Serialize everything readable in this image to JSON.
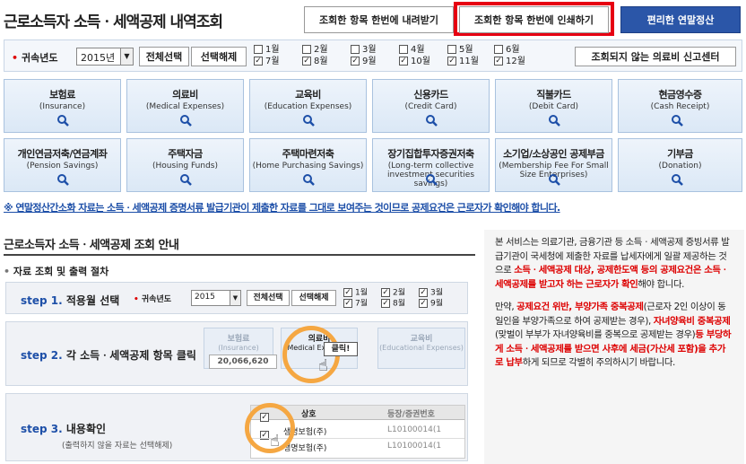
{
  "header": {
    "title": "근로소득자 소득ㆍ세액공제 내역조회",
    "download_label": "조회한 항목 한번에 내려받기",
    "print_label": "조회한 항목 한번에 인쇄하기",
    "easy_label": "편리한 연말정산"
  },
  "filter": {
    "year_label": "귀속년도",
    "year_value": "2015년",
    "select_all_label": "전체선택",
    "deselect_label": "선택해제",
    "months": [
      {
        "top": "1월",
        "bottom": "7월"
      },
      {
        "top": "2월",
        "bottom": "8월"
      },
      {
        "top": "3월",
        "bottom": "9월"
      },
      {
        "top": "4월",
        "bottom": "10월"
      },
      {
        "top": "5월",
        "bottom": "11월"
      },
      {
        "top": "6월",
        "bottom": "12월"
      }
    ],
    "report_label": "조회되지 않는 의료비 신고센터"
  },
  "cards": [
    {
      "k": "보험료",
      "e": "(Insurance)"
    },
    {
      "k": "의료비",
      "e": "(Medical Expenses)"
    },
    {
      "k": "교육비",
      "e": "(Education Expenses)"
    },
    {
      "k": "신용카드",
      "e": "(Credit Card)"
    },
    {
      "k": "직불카드",
      "e": "(Debit Card)"
    },
    {
      "k": "현금영수증",
      "e": "(Cash Receipt)"
    },
    {
      "k": "개인연금저축/연금계좌",
      "e": "(Pension Savings)"
    },
    {
      "k": "주택자금",
      "e": "(Housing Funds)"
    },
    {
      "k": "주택마련저축",
      "e": "(Home Purchasing Savings)"
    },
    {
      "k": "장기집합투자증권저축",
      "e": "(Long-term collective investment securities savings)"
    },
    {
      "k": "소기업/소상공인 공제부금",
      "e": "(Membership Fee For Small Size Enterprises)"
    },
    {
      "k": "기부금",
      "e": "(Donation)"
    }
  ],
  "notice": "※ 연말정산간소화 자료는 소득ㆍ세액공제 증명서류 발급기관이 제출한 자료를 그대로 보여주는 것이므로 공제요건은 근로자가 확인해야 합니다.",
  "guide": {
    "title": "근로소득자 소득ㆍ세액공제 조회 안내",
    "proc_title": "자료 조회 및 출력 절차",
    "step1": {
      "step": "step 1.",
      "name": "적용월 선택",
      "year_label": "귀속년도",
      "year": "2015",
      "select_all": "전체선택",
      "deselect": "선택해제",
      "months": [
        "1월",
        "7월",
        "2월",
        "8월",
        "3월",
        "9월"
      ]
    },
    "step2": {
      "step": "step 2.",
      "name": "각 소득ㆍ세액공제 항목 클릭",
      "c1_k": "보험료",
      "c1_e": "(Insurance)",
      "amount": "20,066,620",
      "c2_k": "의료비",
      "c2_e": "(Medical Expenses)",
      "c3_k": "교육비",
      "c3_e": "(Educational Expenses)",
      "click": "클릭!"
    },
    "step3": {
      "step": "step 3.",
      "name": "내용확인",
      "sub": "(출력하지 않을 자료는 선택해제)",
      "col1": "상호",
      "col2": "등장/증권번호",
      "row1_name": "생명보험(주)",
      "row1_no": "L10100014(1",
      "row2_name": "생명보험(주)",
      "row2_no": "L10100014(1"
    }
  },
  "info": {
    "p1_a": "본 서비스는 의료기관, 금융기관 등 소득ㆍ세액공제 증빙서류 발급기관이 국세청에 제출한 자료를 납세자에게 일괄 제공하는 것으로 ",
    "p1_b": "소득ㆍ세액공제 대상, 공제한도액 등의 공제요건은 소득ㆍ세액공제를 받고자 하는 근로자가 확인",
    "p1_c": "해야 합니다.",
    "p2_a": "만약, ",
    "p2_b": "공제요건 위반, 부양가족 중복공제",
    "p2_c": "(근로자 2인 이상이 동일인을 부양가족으로 하여 공제받는 경우), ",
    "p2_d": "자녀양육비 중복공제",
    "p2_e": "(맞벌이 부부가 자녀양육비를 중복으로 공제받는 경우)",
    "p2_f": "등 부당하게 소득ㆍ세액공제를 받으면 사후에 세금(가산세 포함)을 추가로 납부",
    "p2_g": "하게 되므로 각별히 주의하시기 바랍니다."
  }
}
